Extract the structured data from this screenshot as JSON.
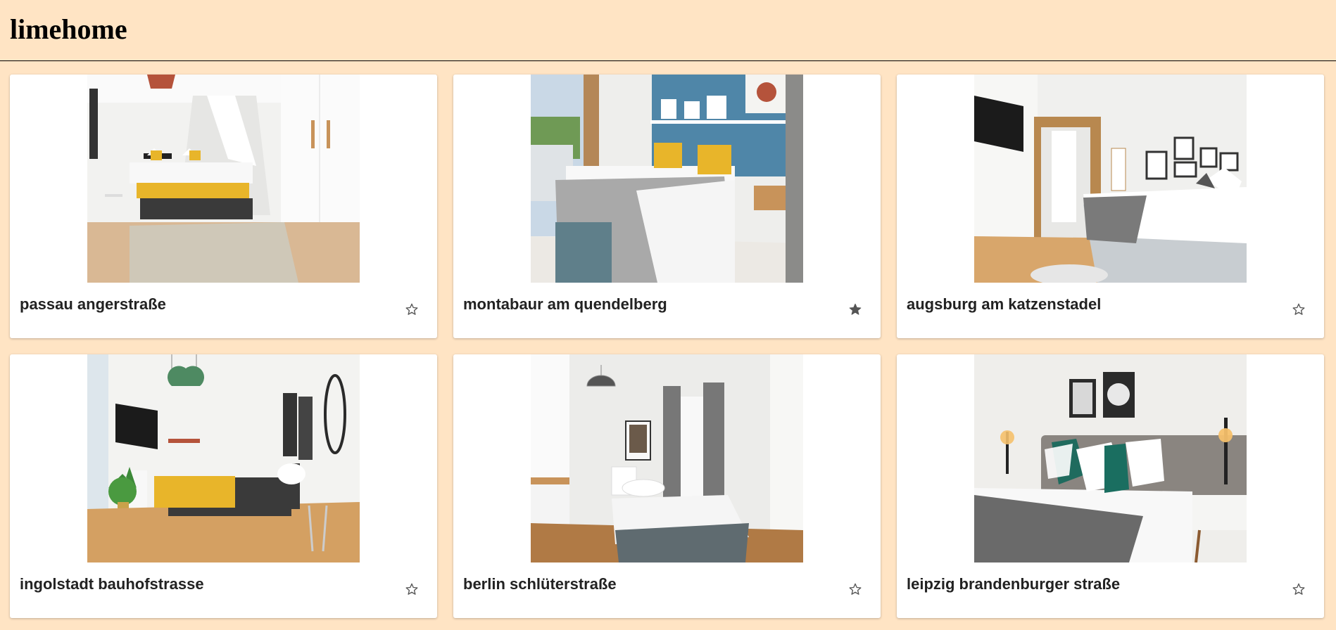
{
  "header": {
    "brand": "limehome"
  },
  "listings": [
    {
      "name": "passau angerstraße",
      "favorite": false
    },
    {
      "name": "montabaur am quendelberg",
      "favorite": true
    },
    {
      "name": "augsburg am katzenstadel",
      "favorite": false
    },
    {
      "name": "ingolstadt bauhofstrasse",
      "favorite": false
    },
    {
      "name": "berlin schlüterstraße",
      "favorite": false
    },
    {
      "name": "leipzig brandenburger straße",
      "favorite": false
    }
  ],
  "colors": {
    "background": "#ffe4c4",
    "card": "#ffffff",
    "star": "#555555"
  },
  "icons": {
    "favorite": "star-icon"
  }
}
